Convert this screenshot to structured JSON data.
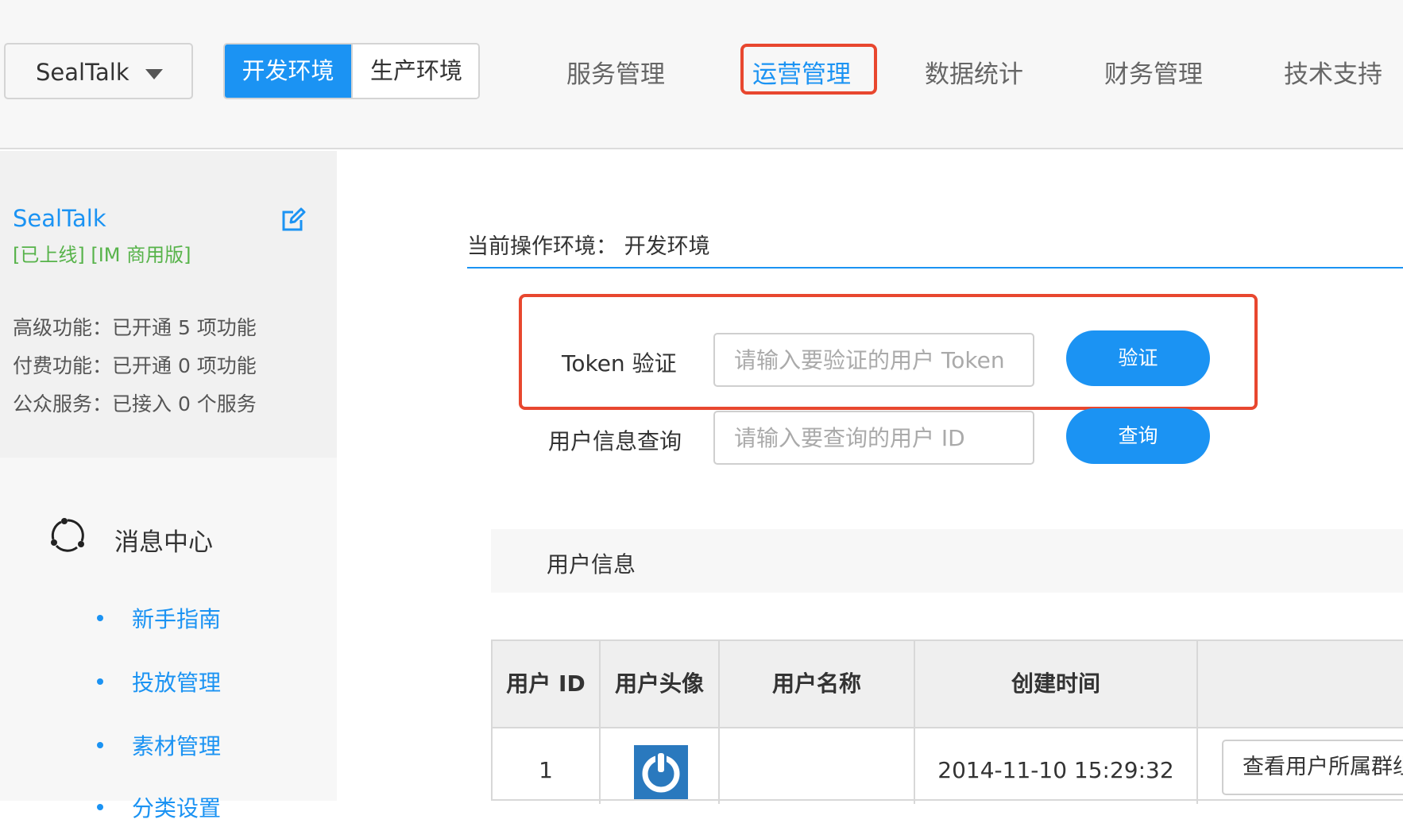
{
  "header": {
    "app_select": "SealTalk",
    "env_tabs": [
      "开发环境",
      "生产环境"
    ],
    "nav": [
      "服务管理",
      "运营管理",
      "数据统计",
      "财务管理",
      "技术支持"
    ],
    "colors": {
      "accent": "#1b93f3",
      "highlight": "#e8472f",
      "status_green": "#57b34a"
    }
  },
  "sidebar": {
    "app_name": "SealTalk",
    "app_status": "[已上线] [IM 商用版]",
    "features": [
      "高级功能：已开通 5 项功能",
      "付费功能：已开通 0 项功能",
      "公众服务：已接入 0 个服务"
    ],
    "section_title": "消息中心",
    "section_icon": "message-center-icon",
    "sub_items": [
      "新手指南",
      "投放管理",
      "素材管理",
      "分类设置"
    ]
  },
  "main": {
    "env_label": "当前操作环境：  开发环境",
    "token": {
      "label": "Token 验证",
      "placeholder": "请输入要验证的用户 Token",
      "button": "验证"
    },
    "query": {
      "label": "用户信息查询",
      "placeholder": "请输入要查询的用户 ID",
      "button": "查询"
    },
    "user_info_title": "用户信息",
    "table": {
      "headers": [
        "用户 ID",
        "用户头像",
        "用户名称",
        "创建时间",
        ""
      ],
      "rows": [
        {
          "id": "1",
          "avatar_icon": "power-avatar-icon",
          "name": "",
          "created": "2014-11-10 15:29:32",
          "action": "查看用户所属群组"
        }
      ]
    }
  }
}
